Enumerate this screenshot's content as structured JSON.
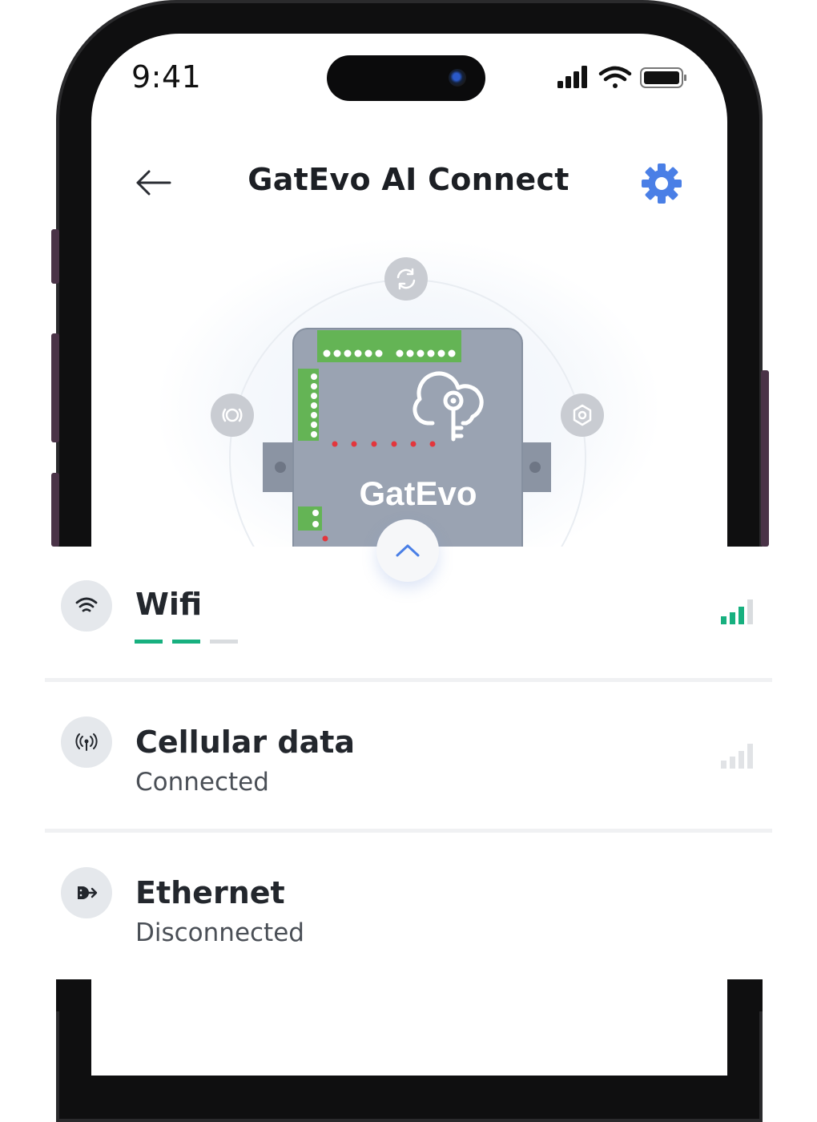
{
  "status_bar": {
    "time": "9:41"
  },
  "header": {
    "title": "GatEvo AI Connect"
  },
  "device": {
    "brand": "GatEvo"
  },
  "connections": [
    {
      "label": "Wifi",
      "status": "",
      "signal_bars": 3,
      "setup_steps_done": 2,
      "setup_steps_total": 3
    },
    {
      "label": "Cellular data",
      "status": "Connected",
      "signal_bars": 0
    },
    {
      "label": "Ethernet",
      "status": "Disconnected"
    }
  ],
  "colors": {
    "accent": "#4a7fe6",
    "signal_active": "#17b07f",
    "signal_inactive": "#d9dcdf",
    "device_body": "#9aa3b2",
    "terminal_green": "#64b455",
    "led_red": "#e3363c"
  },
  "icons": {
    "back": "arrow-left-icon",
    "settings": "gear-icon",
    "sync": "sync-icon",
    "expand": "chevron-up-icon",
    "wifi": "wifi-icon",
    "cellular": "cellular-antenna-icon",
    "ethernet": "ethernet-icon"
  }
}
